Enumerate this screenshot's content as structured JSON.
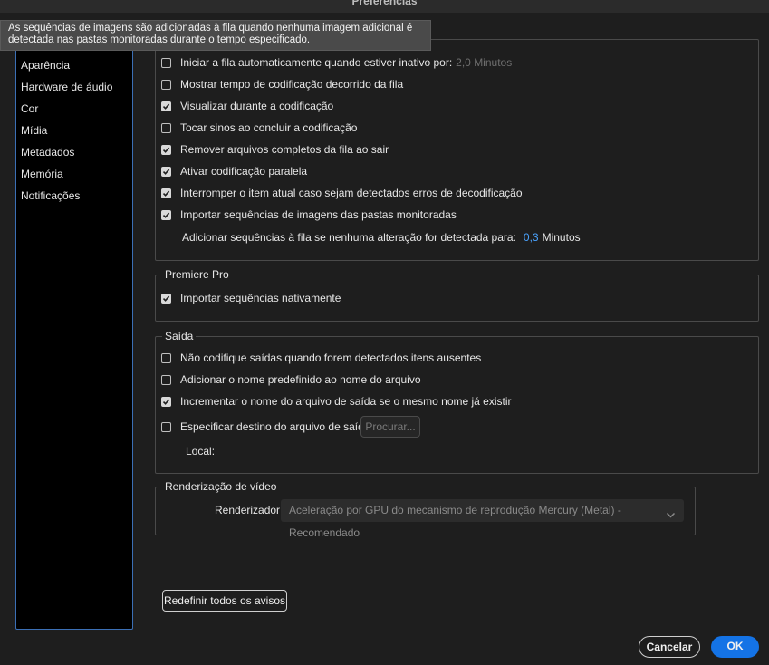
{
  "window": {
    "title": "Preferências"
  },
  "tooltip": {
    "text": "As sequências de imagens são adicionadas à fila quando nenhuma imagem adicional é detectada nas pastas monitoradas durante o tempo especificado."
  },
  "sidebar": {
    "items": [
      {
        "label": "Aparência"
      },
      {
        "label": "Hardware de áudio"
      },
      {
        "label": "Cor"
      },
      {
        "label": "Mídia"
      },
      {
        "label": "Metadados"
      },
      {
        "label": "Memória"
      },
      {
        "label": "Notificações"
      }
    ]
  },
  "general": {
    "options": [
      {
        "label": "Iniciar a fila automaticamente quando estiver inativo por:",
        "checked": false,
        "suffix": "2,0 Minutos"
      },
      {
        "label": "Mostrar tempo de codificação decorrido da fila",
        "checked": false
      },
      {
        "label": "Visualizar durante a codificação",
        "checked": true
      },
      {
        "label": "Tocar sinos ao concluir a codificação",
        "checked": false
      },
      {
        "label": "Remover arquivos completos da fila ao sair",
        "checked": true
      },
      {
        "label": "Ativar codificação paralela",
        "checked": true
      },
      {
        "label": "Interromper o item atual caso sejam detectados erros de decodificação",
        "checked": true
      },
      {
        "label": "Importar sequências de imagens das pastas monitoradas",
        "checked": true
      }
    ],
    "sub": {
      "label": "Adicionar sequências à fila se nenhuma alteração for detectada para:",
      "value": "0,3",
      "unit": "Minutos"
    }
  },
  "premiere": {
    "title": "Premiere Pro",
    "options": [
      {
        "label": "Importar sequências nativamente",
        "checked": true
      }
    ]
  },
  "output": {
    "title": "Saída",
    "options": [
      {
        "label": "Não codifique saídas quando forem detectados itens ausentes",
        "checked": false
      },
      {
        "label": "Adicionar o nome predefinido ao nome do arquivo",
        "checked": false
      },
      {
        "label": "Incrementar o nome do arquivo de saída se o mesmo nome já existir",
        "checked": true
      },
      {
        "label": "Especificar destino do arquivo de saída:",
        "checked": false
      }
    ],
    "browse_label": "Procurar...",
    "local_label": "Local:"
  },
  "render": {
    "title": "Renderização de vídeo",
    "renderer_label": "Renderizador:",
    "renderer_value": "Aceleração por GPU do mecanismo de reprodução Mercury (Metal) - Recomendado"
  },
  "buttons": {
    "reset_warnings": "Redefinir todos os avisos",
    "cancel": "Cancelar",
    "ok": "OK"
  },
  "colors": {
    "accent": "#1473e6",
    "link_value": "#4aa3ff"
  }
}
